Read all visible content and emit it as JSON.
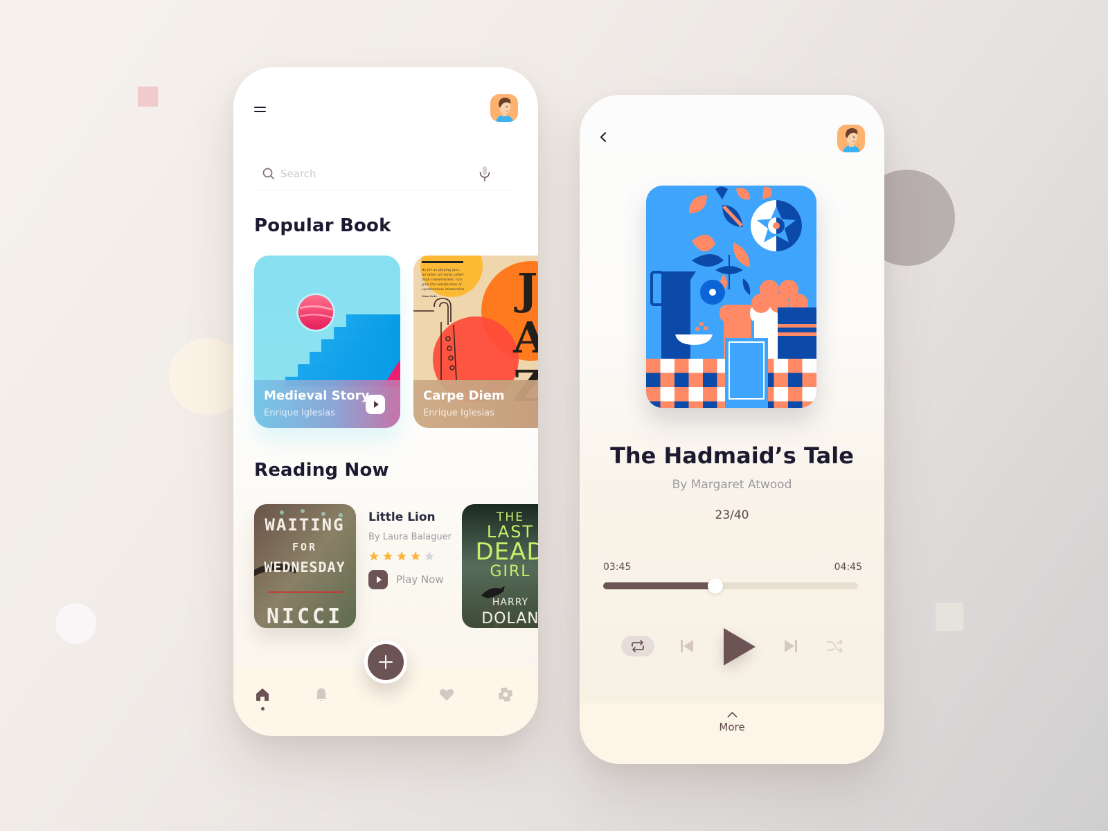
{
  "colors": {
    "accent": "#6d5454",
    "title_text": "#1b1a30",
    "muted_text": "#9b98a0",
    "star_filled": "#fdb43b",
    "star_empty": "#d8d6dc",
    "tabbar_bg": "#fdf6e9"
  },
  "home": {
    "search": {
      "placeholder": "Search",
      "value": ""
    },
    "popular": {
      "title": "Popular Book",
      "books": [
        {
          "title": "Medieval Story",
          "author": "Enrique Iglesias"
        },
        {
          "title": "Carpe Diem",
          "author": "Enrique Iglesias",
          "cover_text": "JAZZ",
          "cover_quote": "As for as playing jazz, no other art form, other than conversation, can give the satisfaction of spontaneous interaction.",
          "cover_quote_author": "Stan Getz"
        }
      ]
    },
    "reading_now": {
      "title": "Reading Now",
      "current": {
        "title": "Little Lion",
        "author": "By Laura Balaguer",
        "rating": 4,
        "rating_max": 5,
        "play_label": "Play Now",
        "cover": {
          "line1": "WAITING",
          "line2": "FOR",
          "line3": "WEDNESDAY",
          "author": "NICCI"
        }
      },
      "next_cover": {
        "line1": "THE",
        "line2": "LAST",
        "line3": "DEAD",
        "line4": "GIRL",
        "author_first": "HARRY",
        "author_last": "DOLAN"
      }
    },
    "tabs": [
      {
        "name": "home",
        "icon": "home-icon",
        "active": true
      },
      {
        "name": "notifications",
        "icon": "bell-icon",
        "active": false
      },
      {
        "name": "favorites",
        "icon": "heart-icon",
        "active": false
      },
      {
        "name": "settings",
        "icon": "gear-icon",
        "active": false
      }
    ],
    "fab_icon": "plus-icon"
  },
  "player": {
    "title": "The Hadmaid’s Tale",
    "author": "By Margaret Atwood",
    "chapter": "23/40",
    "time_current": "03:45",
    "time_total": "04:45",
    "progress_fraction": 0.44,
    "controls": [
      "repeat-icon",
      "previous-icon",
      "play-icon",
      "next-icon",
      "shuffle-icon"
    ],
    "more_label": "More"
  }
}
